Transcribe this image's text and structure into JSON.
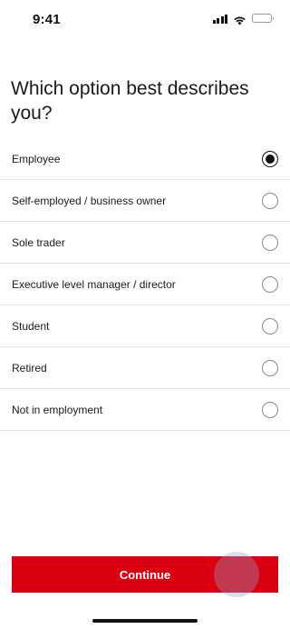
{
  "status_bar": {
    "time": "9:41",
    "icons": [
      "signal-icon",
      "wifi-icon",
      "battery-icon"
    ]
  },
  "question": {
    "title": "Which option best describes you?"
  },
  "options": [
    {
      "label": "Employee",
      "selected": true
    },
    {
      "label": "Self-employed / business owner",
      "selected": false
    },
    {
      "label": "Sole trader",
      "selected": false
    },
    {
      "label": "Executive level manager / director",
      "selected": false
    },
    {
      "label": "Student",
      "selected": false
    },
    {
      "label": "Retired",
      "selected": false
    },
    {
      "label": "Not in employment",
      "selected": false
    }
  ],
  "actions": {
    "continue_label": "Continue"
  },
  "colors": {
    "primary": "#db0011",
    "text": "#1a1a1a",
    "divider": "#e3e3e3"
  }
}
